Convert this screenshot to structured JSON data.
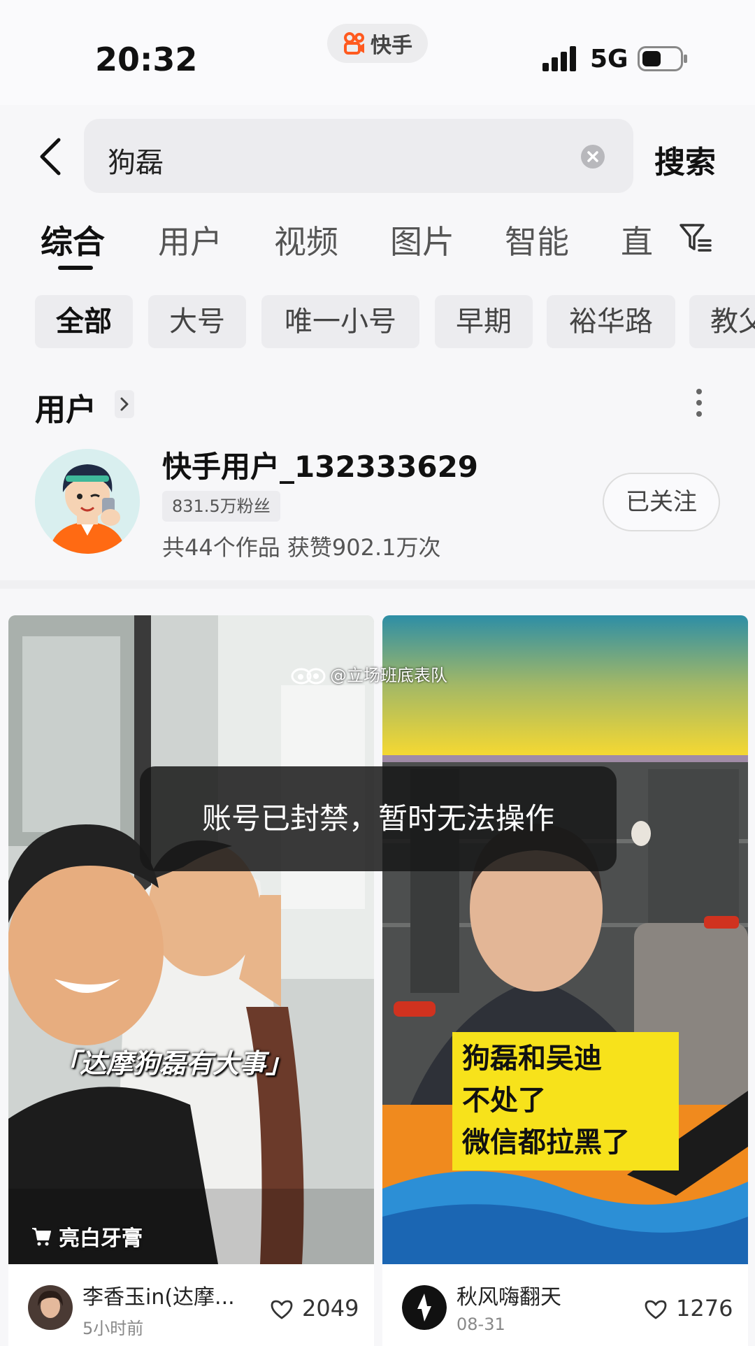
{
  "status_bar": {
    "time": "20:32",
    "app_name": "快手",
    "network": "5G"
  },
  "search": {
    "query": "狗磊",
    "button_label": "搜索"
  },
  "tabs": [
    "综合",
    "用户",
    "视频",
    "图片",
    "智能",
    "直"
  ],
  "chips": [
    "全部",
    "大号",
    "唯一小号",
    "早期",
    "裕华路",
    "教父"
  ],
  "user_section": {
    "title": "用户",
    "username": "快手用户_132333629",
    "fans": "831.5万粉丝",
    "works": "共44个作品 获赞902.1万次",
    "follow_label": "已关注"
  },
  "videos": [
    {
      "caption": "「达摩狗磊有大事」",
      "product_tag": "亮白牙膏",
      "author": "李香玉in(达摩...",
      "time": "5小时前",
      "likes": "2049"
    },
    {
      "caption_lines": [
        "狗磊和吴迪",
        "不处了",
        "微信都拉黑了"
      ],
      "author": "秋风嗨翻天",
      "time": "08-31",
      "likes": "1276"
    }
  ],
  "watermark": "@立场班底表队",
  "toast": "账号已封禁，暂时无法操作"
}
